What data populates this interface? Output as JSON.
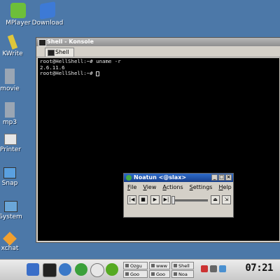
{
  "desktop": {
    "icons": [
      {
        "label": "MPlayer",
        "icon": "mplayer-icon",
        "color": "#6dbf3a"
      },
      {
        "label": "Download",
        "icon": "download-icon",
        "color": "#3d7ad6"
      },
      {
        "label": "KWrite",
        "icon": "kwrite-icon",
        "color": "#e0c63a"
      },
      {
        "label": "movie",
        "icon": "movie-folder-icon",
        "color": "#9aa6b4"
      },
      {
        "label": "mp3",
        "icon": "mp3-folder-icon",
        "color": "#9aa6b4"
      },
      {
        "label": "Printer",
        "icon": "printer-icon",
        "color": "#e7e7e7"
      },
      {
        "label": "Snap",
        "icon": "snapshot-icon",
        "color": "#5aa0e0"
      },
      {
        "label": "System",
        "icon": "system-icon",
        "color": "#6aa6d8"
      },
      {
        "label": "xchat",
        "icon": "xchat-icon",
        "color": "#f0a030"
      }
    ]
  },
  "konsole": {
    "title": "Shell - Konsole",
    "tab_label": "Shell",
    "lines": [
      "root@HellShell:~# uname -r",
      "2.6.11.6",
      "root@HellShell:~# "
    ]
  },
  "noatun": {
    "title": "Noatun <@slax>",
    "menu": [
      "File",
      "View",
      "Actions",
      "Settings",
      "Help"
    ],
    "menu_mnemonics": [
      "F",
      "V",
      "A",
      "S",
      "H"
    ],
    "controls": [
      "previous",
      "stop",
      "play",
      "next",
      "eject",
      "loop"
    ],
    "control_glyphs": [
      "|◀",
      "■",
      "▶",
      "▶|",
      "⏏",
      "⇲"
    ]
  },
  "taskbar": {
    "tasks": [
      "Ozgu",
      "www",
      "Shell",
      "Goo",
      "Goo",
      "Noa"
    ],
    "clock": "07:21"
  },
  "colors": {
    "desktop": "#4c78a8",
    "konsole_title": "#a0a0a0",
    "noatun_title": "#1f4fa8",
    "terminal_bg": "#000000"
  }
}
